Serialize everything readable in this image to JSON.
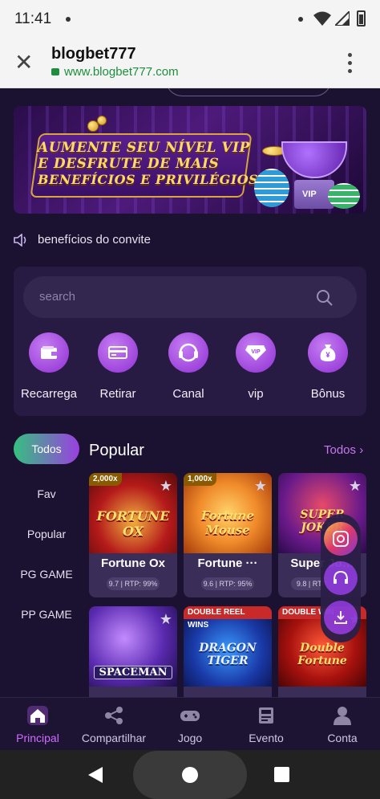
{
  "status": {
    "time": "11:41"
  },
  "browser": {
    "site_name": "blogbet777",
    "url": "www.blogbet777.com"
  },
  "banner": {
    "line1": "AUMENTE SEU NÍVEL VIP",
    "line2": "E DESFRUTE DE MAIS",
    "line3": "BENEFÍCIOS E PRIVILÉGIOS",
    "cup_label": "VIP"
  },
  "notice": {
    "text": "benefícios do convite"
  },
  "search": {
    "placeholder": "search"
  },
  "quick_actions": [
    {
      "label": "Recarrega",
      "icon": "wallet-icon"
    },
    {
      "label": "Retirar",
      "icon": "card-icon"
    },
    {
      "label": "Canal",
      "icon": "headset-icon"
    },
    {
      "label": "vip",
      "icon": "vip-icon"
    },
    {
      "label": "Bônus",
      "icon": "money-bag-icon"
    }
  ],
  "categories": {
    "active": "Todos",
    "items": [
      "Fav",
      "Popular",
      "PG GAME",
      "PP GAME"
    ]
  },
  "section": {
    "title": "Popular",
    "more": "Todos"
  },
  "games": [
    {
      "badge": "2,000x",
      "logo": "FORTUNE OX",
      "name": "Fortune Ox",
      "rtp": "9.7 | RTP: 99%"
    },
    {
      "badge": "1,000x",
      "logo": "Fortune Mouse",
      "name": "Fortune ···",
      "rtp": "9.6 | RTP: 95%"
    },
    {
      "badge": "",
      "logo": "SUPER JOKER",
      "name": "Super Jo…",
      "rtp": "9.8 | RTP:"
    },
    {
      "badge": "",
      "logo": "SPACEMAN",
      "name": "",
      "rtp": ""
    },
    {
      "badge": "DOUBLE REEL WINS",
      "logo": "DRAGON TIGER",
      "name": "",
      "rtp": ""
    },
    {
      "badge": "DOUBLE WIN",
      "logo": "Double Fortune",
      "name": "",
      "rtp": ""
    }
  ],
  "tabs": [
    {
      "label": "Principal",
      "icon": "home-icon",
      "active": true
    },
    {
      "label": "Compartilhar",
      "icon": "share-icon"
    },
    {
      "label": "Jogo",
      "icon": "gamepad-icon"
    },
    {
      "label": "Evento",
      "icon": "news-icon"
    },
    {
      "label": "Conta",
      "icon": "user-icon"
    }
  ],
  "colors": {
    "bg": "#1a1230",
    "accent": "#cf6cff",
    "panel": "#271b43"
  }
}
